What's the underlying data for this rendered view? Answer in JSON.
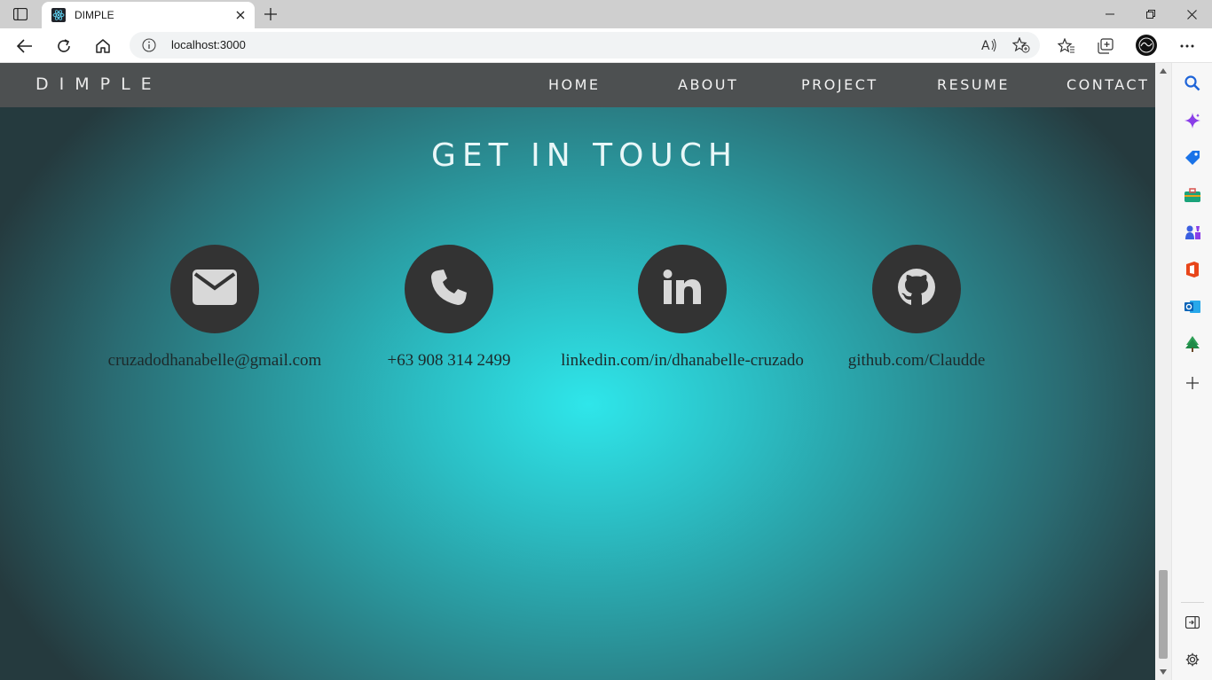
{
  "browser": {
    "tab_title": "DIMPLE",
    "url": "localhost:3000"
  },
  "site": {
    "brand": "DIMPLE",
    "nav": [
      {
        "label": "HOME"
      },
      {
        "label": "ABOUT"
      },
      {
        "label": "PROJECT"
      },
      {
        "label": "RESUME"
      },
      {
        "label": "CONTACT"
      }
    ],
    "section_title": "GET IN TOUCH",
    "contacts": [
      {
        "icon": "envelope-icon",
        "text": "cruzadodhanabelle@gmail.com"
      },
      {
        "icon": "phone-icon",
        "text": "+63 908 314 2499"
      },
      {
        "icon": "linkedin-icon",
        "text": "linkedin.com/in/dhanabelle-cruzado"
      },
      {
        "icon": "github-icon",
        "text": "github.com/Claudde"
      }
    ]
  },
  "colors": {
    "navbar": "#4d5051",
    "icon_circle": "#333333",
    "accent_center": "#2fe6ea"
  }
}
